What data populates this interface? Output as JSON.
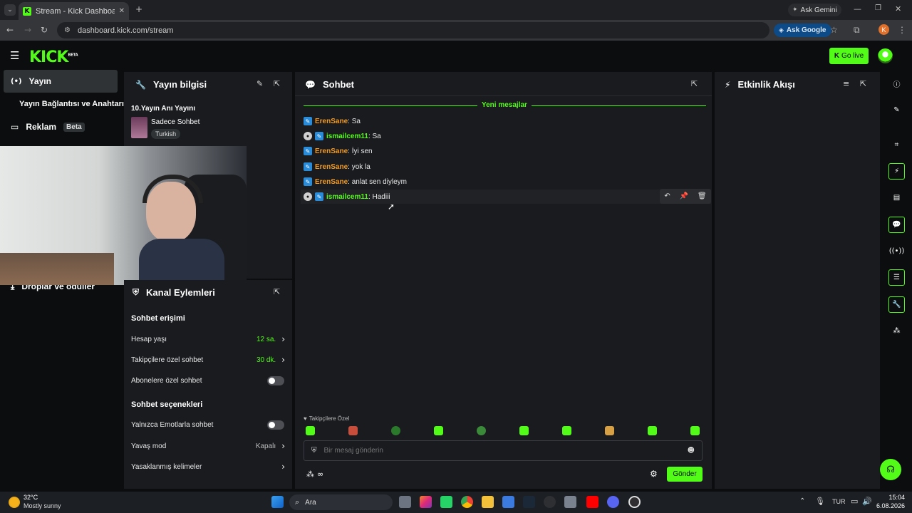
{
  "browser": {
    "tab_title": "Stream - Kick Dashboard",
    "url": "dashboard.kick.com/stream",
    "ask_gemini": "Ask Gemini",
    "ask_google": "Ask Google",
    "profile_letter": "K"
  },
  "app": {
    "logo": "KICK",
    "logo_badge": "BETA",
    "go_live": "Go live"
  },
  "sidebar": {
    "items": [
      {
        "label": "Yayın"
      },
      {
        "label": "Yayın Bağlantısı ve Anahtarı"
      },
      {
        "label": "Reklam",
        "badge": "Beta"
      },
      {
        "label": "Droplar ve ödüller"
      }
    ]
  },
  "stream_info": {
    "title": "Yayın bilgisi",
    "stream_name": "10.Yayın Anı Yayını",
    "category": "Sadece Sohbet",
    "tag": "Turkish"
  },
  "channel_actions": {
    "title": "Kanal Eylemleri",
    "chat_access_heading": "Sohbet erişimi",
    "rows": [
      {
        "label": "Hesap yaşı",
        "value": "12 sa."
      },
      {
        "label": "Takipçilere özel sohbet",
        "value": "30 dk."
      },
      {
        "label": "Abonelere özel sohbet"
      }
    ],
    "chat_options_heading": "Sohbet seçenekleri",
    "option_rows": [
      {
        "label": "Yalnızca Emotlarla sohbet"
      },
      {
        "label": "Yavaş mod",
        "value": "Kapalı"
      },
      {
        "label": "Yasaklanmış kelimeler"
      }
    ]
  },
  "chat": {
    "title": "Sohbet",
    "new_messages": "Yeni mesajlar",
    "messages": [
      {
        "user": "ErenSane",
        "text": "Sa"
      },
      {
        "user": "ismailcem11",
        "text": "Sa"
      },
      {
        "user": "ErenSane",
        "text": "İyi sen"
      },
      {
        "user": "ErenSane",
        "text": "yok la"
      },
      {
        "user": "ErenSane",
        "text": "anlat sen diyleym"
      },
      {
        "user": "ismailcem11",
        "text": "Hadiii"
      }
    ],
    "followers_only": "Takipçilere Özel",
    "placeholder": "Bir mesaj gönderin",
    "send": "Gönder",
    "separator": ": "
  },
  "activity": {
    "title": "Etkinlik Akışı"
  },
  "taskbar": {
    "temp": "32°C",
    "weather": "Mostly sunny",
    "search": "Ara",
    "lang": "TUR",
    "time": "15:04",
    "date": "6.08.2026"
  },
  "colors": {
    "accent": "#53fc18",
    "panel": "#191b1f",
    "background": "#0b0d0e",
    "user_orange": "#f39a1f"
  }
}
